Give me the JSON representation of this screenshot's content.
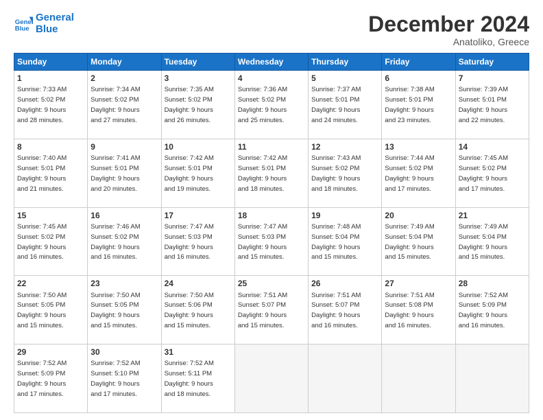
{
  "header": {
    "logo_line1": "General",
    "logo_line2": "Blue",
    "month": "December 2024",
    "location": "Anatoliko, Greece"
  },
  "weekdays": [
    "Sunday",
    "Monday",
    "Tuesday",
    "Wednesday",
    "Thursday",
    "Friday",
    "Saturday"
  ],
  "weeks": [
    [
      {
        "day": 1,
        "sunrise": "7:33 AM",
        "sunset": "5:02 PM",
        "daylight": "9 hours and 28 minutes."
      },
      {
        "day": 2,
        "sunrise": "7:34 AM",
        "sunset": "5:02 PM",
        "daylight": "9 hours and 27 minutes."
      },
      {
        "day": 3,
        "sunrise": "7:35 AM",
        "sunset": "5:02 PM",
        "daylight": "9 hours and 26 minutes."
      },
      {
        "day": 4,
        "sunrise": "7:36 AM",
        "sunset": "5:02 PM",
        "daylight": "9 hours and 25 minutes."
      },
      {
        "day": 5,
        "sunrise": "7:37 AM",
        "sunset": "5:01 PM",
        "daylight": "9 hours and 24 minutes."
      },
      {
        "day": 6,
        "sunrise": "7:38 AM",
        "sunset": "5:01 PM",
        "daylight": "9 hours and 23 minutes."
      },
      {
        "day": 7,
        "sunrise": "7:39 AM",
        "sunset": "5:01 PM",
        "daylight": "9 hours and 22 minutes."
      }
    ],
    [
      {
        "day": 8,
        "sunrise": "7:40 AM",
        "sunset": "5:01 PM",
        "daylight": "9 hours and 21 minutes."
      },
      {
        "day": 9,
        "sunrise": "7:41 AM",
        "sunset": "5:01 PM",
        "daylight": "9 hours and 20 minutes."
      },
      {
        "day": 10,
        "sunrise": "7:42 AM",
        "sunset": "5:01 PM",
        "daylight": "9 hours and 19 minutes."
      },
      {
        "day": 11,
        "sunrise": "7:42 AM",
        "sunset": "5:01 PM",
        "daylight": "9 hours and 18 minutes."
      },
      {
        "day": 12,
        "sunrise": "7:43 AM",
        "sunset": "5:02 PM",
        "daylight": "9 hours and 18 minutes."
      },
      {
        "day": 13,
        "sunrise": "7:44 AM",
        "sunset": "5:02 PM",
        "daylight": "9 hours and 17 minutes."
      },
      {
        "day": 14,
        "sunrise": "7:45 AM",
        "sunset": "5:02 PM",
        "daylight": "9 hours and 17 minutes."
      }
    ],
    [
      {
        "day": 15,
        "sunrise": "7:45 AM",
        "sunset": "5:02 PM",
        "daylight": "9 hours and 16 minutes."
      },
      {
        "day": 16,
        "sunrise": "7:46 AM",
        "sunset": "5:02 PM",
        "daylight": "9 hours and 16 minutes."
      },
      {
        "day": 17,
        "sunrise": "7:47 AM",
        "sunset": "5:03 PM",
        "daylight": "9 hours and 16 minutes."
      },
      {
        "day": 18,
        "sunrise": "7:47 AM",
        "sunset": "5:03 PM",
        "daylight": "9 hours and 15 minutes."
      },
      {
        "day": 19,
        "sunrise": "7:48 AM",
        "sunset": "5:04 PM",
        "daylight": "9 hours and 15 minutes."
      },
      {
        "day": 20,
        "sunrise": "7:49 AM",
        "sunset": "5:04 PM",
        "daylight": "9 hours and 15 minutes."
      },
      {
        "day": 21,
        "sunrise": "7:49 AM",
        "sunset": "5:04 PM",
        "daylight": "9 hours and 15 minutes."
      }
    ],
    [
      {
        "day": 22,
        "sunrise": "7:50 AM",
        "sunset": "5:05 PM",
        "daylight": "9 hours and 15 minutes."
      },
      {
        "day": 23,
        "sunrise": "7:50 AM",
        "sunset": "5:05 PM",
        "daylight": "9 hours and 15 minutes."
      },
      {
        "day": 24,
        "sunrise": "7:50 AM",
        "sunset": "5:06 PM",
        "daylight": "9 hours and 15 minutes."
      },
      {
        "day": 25,
        "sunrise": "7:51 AM",
        "sunset": "5:07 PM",
        "daylight": "9 hours and 15 minutes."
      },
      {
        "day": 26,
        "sunrise": "7:51 AM",
        "sunset": "5:07 PM",
        "daylight": "9 hours and 16 minutes."
      },
      {
        "day": 27,
        "sunrise": "7:51 AM",
        "sunset": "5:08 PM",
        "daylight": "9 hours and 16 minutes."
      },
      {
        "day": 28,
        "sunrise": "7:52 AM",
        "sunset": "5:09 PM",
        "daylight": "9 hours and 16 minutes."
      }
    ],
    [
      {
        "day": 29,
        "sunrise": "7:52 AM",
        "sunset": "5:09 PM",
        "daylight": "9 hours and 17 minutes."
      },
      {
        "day": 30,
        "sunrise": "7:52 AM",
        "sunset": "5:10 PM",
        "daylight": "9 hours and 17 minutes."
      },
      {
        "day": 31,
        "sunrise": "7:52 AM",
        "sunset": "5:11 PM",
        "daylight": "9 hours and 18 minutes."
      },
      null,
      null,
      null,
      null
    ]
  ]
}
